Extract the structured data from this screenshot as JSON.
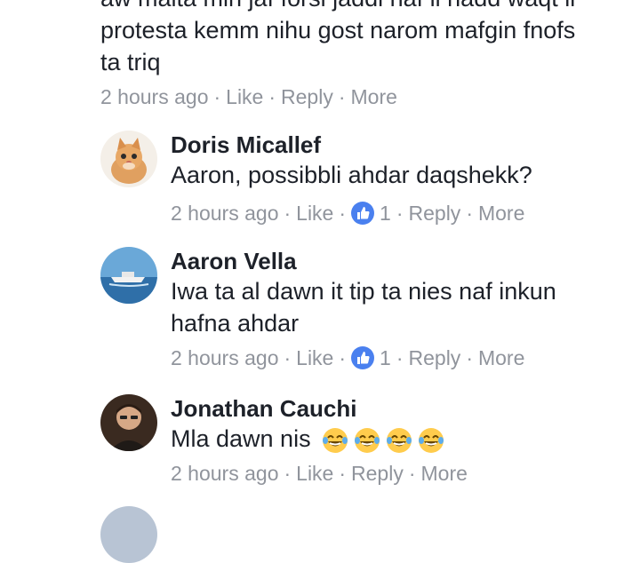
{
  "top_comment": {
    "lines": [
      "aw malta min jaf forsi jaddi naf li nadd waqt li",
      "protesta kemm nihu gost narom mafgin fnofs",
      "ta triq"
    ],
    "time": "2 hours ago",
    "like": "Like",
    "reply": "Reply",
    "more": "More"
  },
  "replies": [
    {
      "name": "Doris Micallef",
      "avatar_icon": "kitten-avatar",
      "lines": [
        "Aaron, possibbli ahdar daqshekk?"
      ],
      "time": "2 hours ago",
      "like": "Like",
      "reaction_count": "1",
      "reply": "Reply",
      "more": "More"
    },
    {
      "name": "Aaron Vella",
      "avatar_icon": "boat-avatar",
      "lines": [
        "Iwa ta al dawn it tip ta nies naf inkun",
        "hafna ahdar"
      ],
      "time": "2 hours ago",
      "like": "Like",
      "reaction_count": "1",
      "reply": "Reply",
      "more": "More"
    },
    {
      "name": "Jonathan Cauchi",
      "avatar_icon": "man-avatar",
      "lines": [
        "Mla dawn nis"
      ],
      "emoji_count": 4,
      "time": "2 hours ago",
      "like": "Like",
      "reply": "Reply",
      "more": "More"
    }
  ],
  "colors": {
    "meta": "#90949c",
    "text": "#1d2129",
    "like_badge": "#4a80ef"
  }
}
